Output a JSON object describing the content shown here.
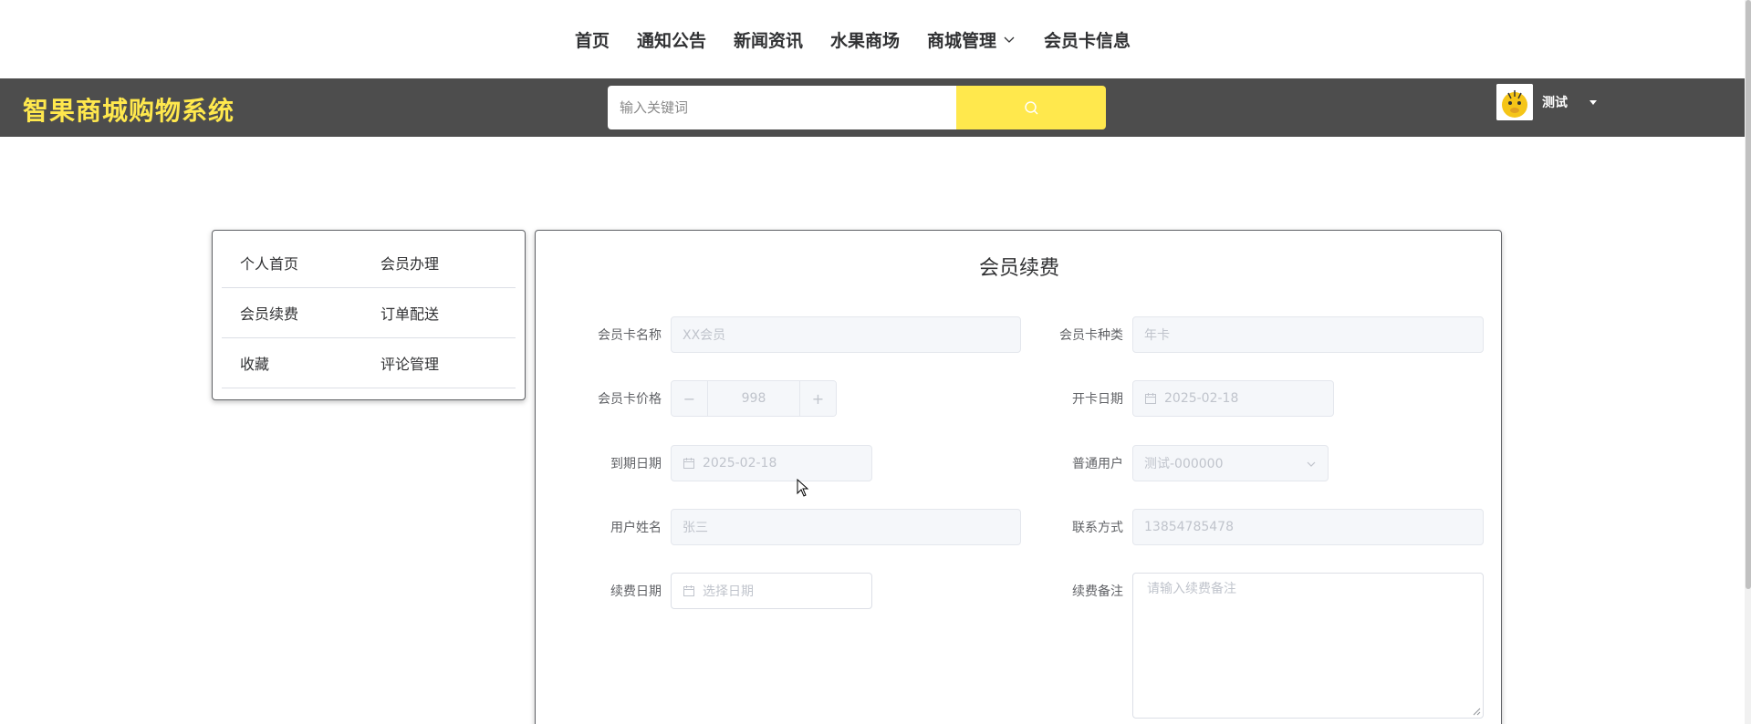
{
  "topnav": {
    "items": [
      "首页",
      "通知公告",
      "新闻资讯",
      "水果商场",
      "商城管理",
      "会员卡信息"
    ]
  },
  "header": {
    "brand": "智果商城购物系统",
    "search_placeholder": "输入关键词",
    "username": "测试"
  },
  "colors": {
    "accent": "#ffe84d",
    "header_bg": "#4d4d4d"
  },
  "sidemenu": {
    "rows": [
      [
        "个人首页",
        "会员办理"
      ],
      [
        "会员续费",
        "订单配送"
      ],
      [
        "收藏",
        "评论管理"
      ]
    ]
  },
  "form": {
    "title": "会员续费",
    "card_name_label": "会员卡名称",
    "card_name_value": "XX会员",
    "card_type_label": "会员卡种类",
    "card_type_value": "年卡",
    "card_price_label": "会员卡价格",
    "card_price_value": "998",
    "open_date_label": "开卡日期",
    "open_date_value": "2025-02-18",
    "expire_date_label": "到期日期",
    "expire_date_value": "2025-02-18",
    "user_label": "普通用户",
    "user_value": "测试-000000",
    "user_name_label": "用户姓名",
    "user_name_value": "张三",
    "contact_label": "联系方式",
    "contact_value": "13854785478",
    "renew_date_label": "续费日期",
    "renew_date_placeholder": "选择日期",
    "renew_note_label": "续费备注",
    "renew_note_placeholder": "请输入续费备注"
  }
}
